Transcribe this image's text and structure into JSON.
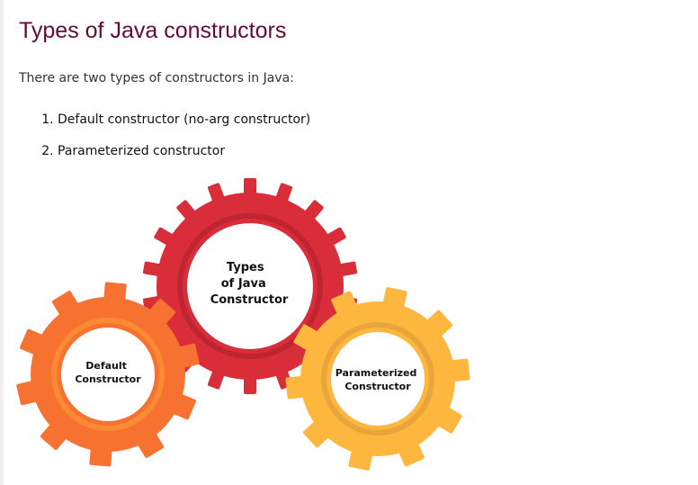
{
  "heading": "Types of Java constructors",
  "intro": "There are two types of constructors in Java:",
  "list": [
    "Default constructor (no-arg constructor)",
    "Parameterized constructor"
  ],
  "diagram": {
    "center": {
      "lines": [
        "Types",
        "of Java",
        "Constructor"
      ],
      "color": "#d92d3a"
    },
    "left": {
      "lines": [
        "Default",
        "Constructor"
      ],
      "color": "#f77231"
    },
    "right": {
      "lines": [
        "Parameterized",
        "Constructor"
      ],
      "color": "#fdb73e"
    }
  }
}
